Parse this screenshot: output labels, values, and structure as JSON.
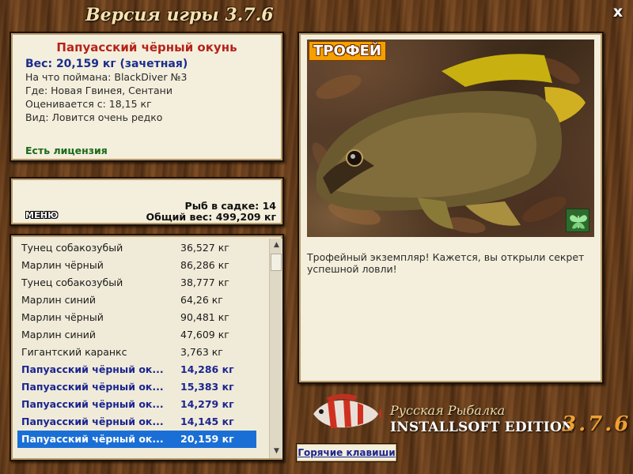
{
  "window": {
    "title": "Версия игры 3.7.6",
    "close_label": "x"
  },
  "fish_info": {
    "name": "Папуасский чёрный окунь",
    "weight": "Вес: 20,159 кг (зачетная)",
    "bait": "На что поймана: BlackDiver №3",
    "location": "Где: Новая Гвинея, Сентани",
    "valued_from": "Оценивается с: 18,15 кг",
    "rarity": "Вид: Ловится очень редко",
    "license": "Есть лицензия"
  },
  "keepnet": {
    "count": "Рыб в садке: 14",
    "total_weight": "Общий вес: 499,209 кг",
    "menu_label": "МЕНЮ"
  },
  "catch_list": [
    {
      "name": "Тунец собакозубый",
      "weight": "36,527 кг",
      "trophy": false
    },
    {
      "name": "Марлин чёрный",
      "weight": "86,286 кг",
      "trophy": false
    },
    {
      "name": "Тунец собакозубый",
      "weight": "38,777 кг",
      "trophy": false
    },
    {
      "name": "Марлин синий",
      "weight": "64,26 кг",
      "trophy": false
    },
    {
      "name": "Марлин чёрный",
      "weight": "90,481 кг",
      "trophy": false
    },
    {
      "name": "Марлин синий",
      "weight": "47,609 кг",
      "trophy": false
    },
    {
      "name": "Гигантский каранкс",
      "weight": "3,763 кг",
      "trophy": false
    },
    {
      "name": "Папуасский чёрный ок...",
      "weight": "14,286 кг",
      "trophy": true
    },
    {
      "name": "Папуасский чёрный ок...",
      "weight": "15,383 кг",
      "trophy": true
    },
    {
      "name": "Папуасский чёрный ок...",
      "weight": "14,279 кг",
      "trophy": true
    },
    {
      "name": "Папуасский чёрный ок...",
      "weight": "14,145 кг",
      "trophy": true
    },
    {
      "name": "Папуасский чёрный ок...",
      "weight": "20,159 кг",
      "trophy": true,
      "selected": true
    }
  ],
  "trophy": {
    "tag": "ТРОФЕЙ",
    "description": "Трофейный экземпляр! Кажется, вы открыли секрет успешной ловли!"
  },
  "logo": {
    "line1": "Русская Рыбалка",
    "line2": "INSTALLSOFT EDITION",
    "version": "3.7.6"
  },
  "hotkeys_label": "Горячие клавиши",
  "colors": {
    "trophy_text": "#1b2590",
    "fish_name": "#b5231b",
    "selection": "#1a6fd6",
    "license": "#1a6a1a"
  }
}
